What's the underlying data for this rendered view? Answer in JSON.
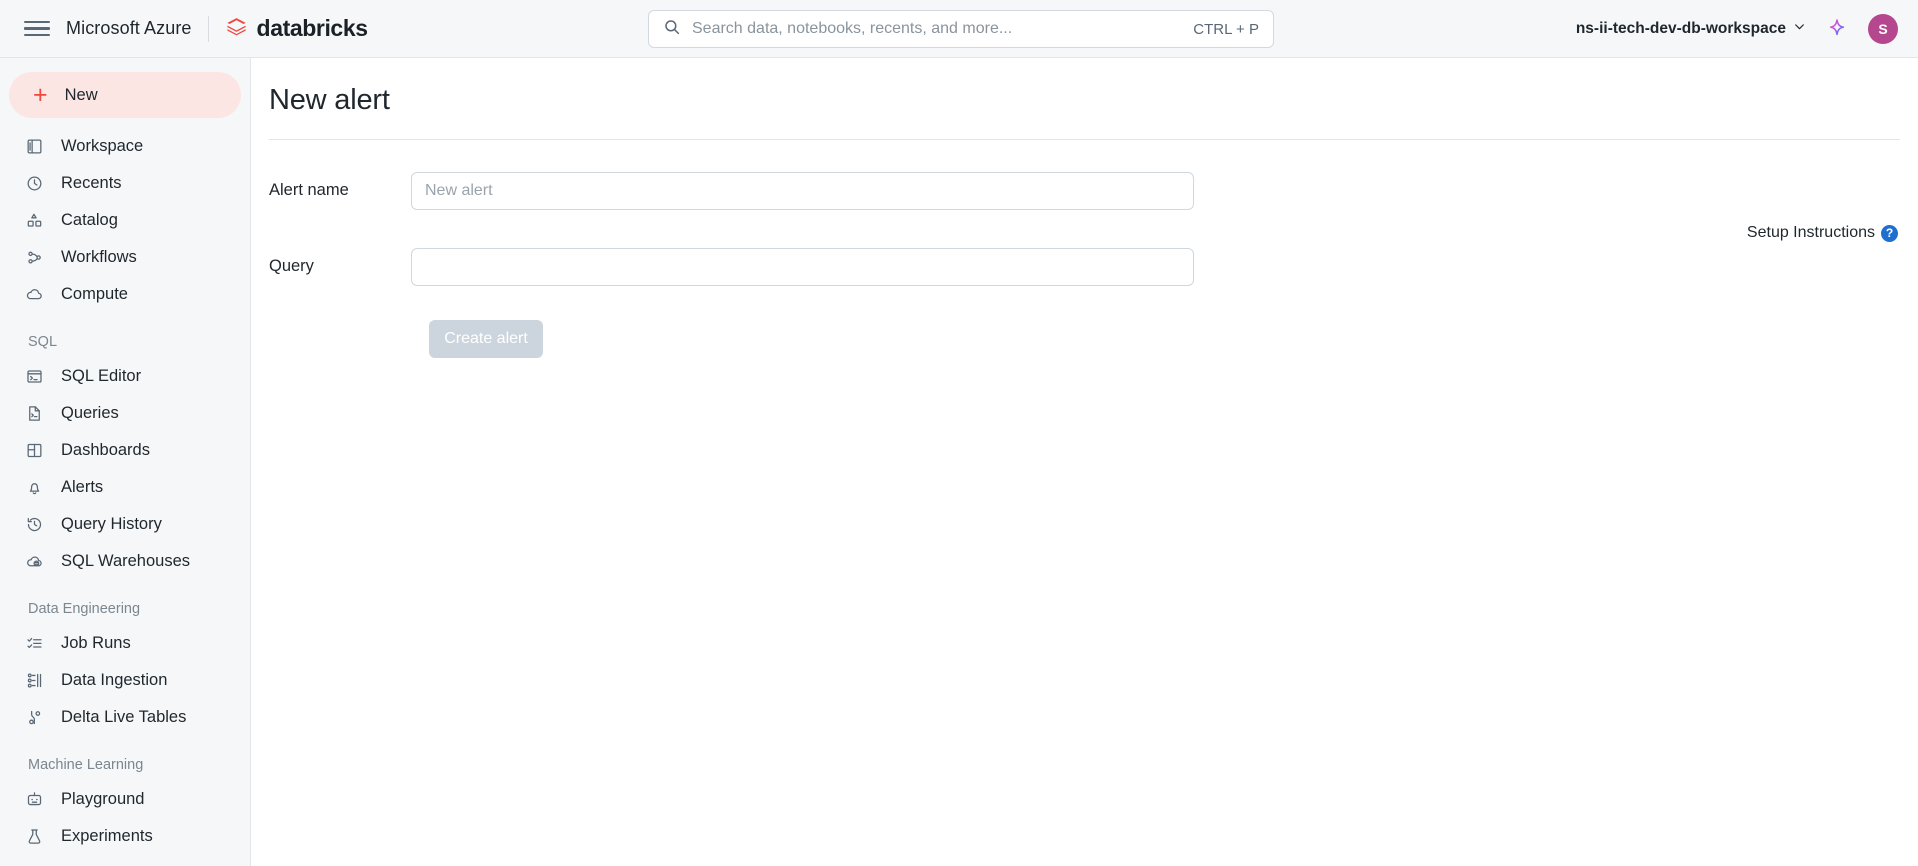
{
  "header": {
    "menu_icon": "hamburger-icon",
    "cloud_brand": "Microsoft Azure",
    "product_brand": "databricks",
    "search": {
      "icon": "search-icon",
      "placeholder": "Search data, notebooks, recents, and more...",
      "shortcut": "CTRL + P"
    },
    "workspace": {
      "name": "ns-ii-tech-dev-db-workspace",
      "chevron": "chevron-down-icon"
    },
    "assistant_icon": "sparkle-icon",
    "avatar": {
      "initial": "S",
      "color": "#b5478f"
    }
  },
  "sidebar": {
    "new_button": {
      "label": "New",
      "icon": "plus-icon",
      "color": "#f0473e",
      "background": "#fbe6e4"
    },
    "groups": [
      {
        "title": "",
        "items": [
          {
            "label": "Workspace",
            "icon": "workspace-icon"
          },
          {
            "label": "Recents",
            "icon": "clock-icon"
          },
          {
            "label": "Catalog",
            "icon": "catalog-icon"
          },
          {
            "label": "Workflows",
            "icon": "workflows-icon"
          },
          {
            "label": "Compute",
            "icon": "cloud-icon"
          }
        ]
      },
      {
        "title": "SQL",
        "items": [
          {
            "label": "SQL Editor",
            "icon": "sql-editor-icon"
          },
          {
            "label": "Queries",
            "icon": "queries-icon"
          },
          {
            "label": "Dashboards",
            "icon": "dashboards-icon"
          },
          {
            "label": "Alerts",
            "icon": "bell-icon"
          },
          {
            "label": "Query History",
            "icon": "history-icon"
          },
          {
            "label": "SQL Warehouses",
            "icon": "warehouse-icon"
          }
        ]
      },
      {
        "title": "Data Engineering",
        "items": [
          {
            "label": "Job Runs",
            "icon": "job-runs-icon"
          },
          {
            "label": "Data Ingestion",
            "icon": "data-ingestion-icon"
          },
          {
            "label": "Delta Live Tables",
            "icon": "delta-live-tables-icon"
          }
        ]
      },
      {
        "title": "Machine Learning",
        "items": [
          {
            "label": "Playground",
            "icon": "robot-icon"
          },
          {
            "label": "Experiments",
            "icon": "experiments-icon"
          }
        ]
      }
    ]
  },
  "main": {
    "page_title": "New alert",
    "fields": {
      "alert_name": {
        "label": "Alert name",
        "value": "",
        "placeholder": "New alert"
      },
      "query": {
        "label": "Query",
        "value": "",
        "placeholder": ""
      }
    },
    "create_button": {
      "label": "Create alert",
      "disabled": true
    },
    "setup_instructions": {
      "label": "Setup Instructions",
      "icon": "help-circle-icon"
    }
  }
}
